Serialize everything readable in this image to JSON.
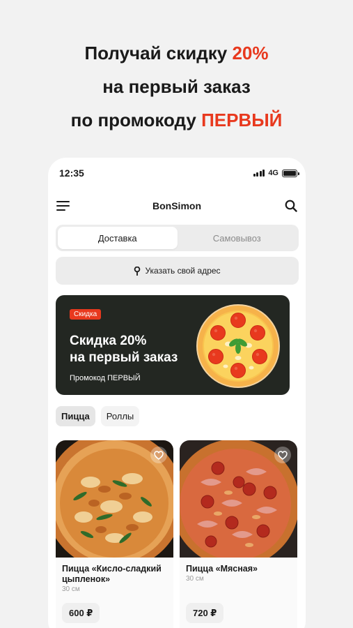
{
  "promo": {
    "line1_prefix": "Получай скидку ",
    "line1_accent": "20%",
    "line2": "на первый заказ",
    "line3_prefix": "по промокоду ",
    "line3_accent": "ПЕРВЫЙ"
  },
  "status_bar": {
    "time": "12:35",
    "network": "4G"
  },
  "header": {
    "title": "BonSimon",
    "menu_icon": "hamburger-menu-icon",
    "search_icon": "search-icon"
  },
  "delivery_mode": {
    "tabs": [
      {
        "label": "Доставка",
        "active": true
      },
      {
        "label": "Самовывоз",
        "active": false
      }
    ]
  },
  "address": {
    "label": "Указать свой адрес",
    "icon": "location-pin-icon"
  },
  "banner": {
    "badge": "Скидка",
    "title_line1": "Скидка 20%",
    "title_line2": "на первый заказ",
    "promo_code": "Промокод ПЕРВЫЙ"
  },
  "categories": [
    {
      "label": "Пицца",
      "active": true
    },
    {
      "label": "Роллы",
      "active": false
    }
  ],
  "products": [
    {
      "name": "Пицца «Кисло-сладкий цыпленок»",
      "size": "30 см",
      "price": "600 ₽",
      "favorite_icon": "heart-icon"
    },
    {
      "name": "Пицца «Мясная»",
      "size": "30 см",
      "price": "720 ₽",
      "favorite_icon": "heart-icon"
    }
  ],
  "colors": {
    "accent": "#e8391e",
    "banner_bg": "#232722",
    "background": "#f2f2f2"
  }
}
